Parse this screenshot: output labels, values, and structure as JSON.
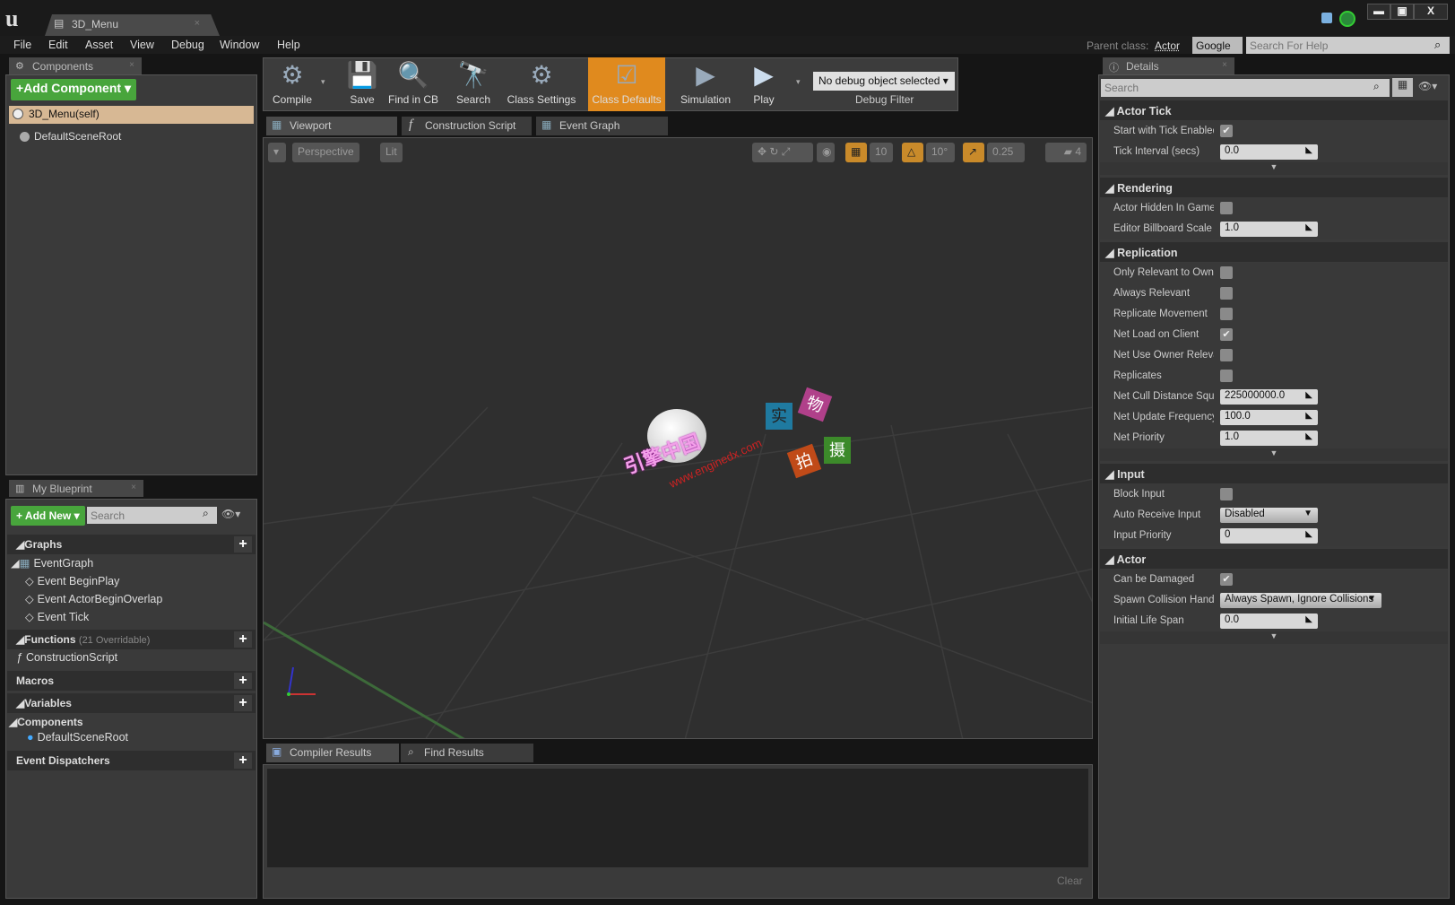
{
  "window": {
    "doc_tab": "3D_Menu",
    "controls": [
      "▬",
      "▣",
      "X"
    ]
  },
  "menu": [
    "File",
    "Edit",
    "Asset",
    "View",
    "Debug",
    "Window",
    "Help"
  ],
  "help": {
    "parent_class_label": "Parent class:",
    "parent_class": "Actor",
    "engine": "Google",
    "search_placeholder": "Search For Help"
  },
  "components": {
    "tab": "Components",
    "add_button": "Add Component",
    "items": [
      "3D_Menu(self)",
      "DefaultSceneRoot"
    ]
  },
  "my_blueprint": {
    "tab": "My Blueprint",
    "add_button": "Add New",
    "search_placeholder": "Search",
    "graphs": "Graphs",
    "event_graph": "EventGraph",
    "events": [
      "Event BeginPlay",
      "Event ActorBeginOverlap",
      "Event Tick"
    ],
    "functions": "Functions",
    "functions_note": "(21 Overridable)",
    "function_items": [
      "ConstructionScript"
    ],
    "macros": "Macros",
    "variables": "Variables",
    "components_group": "Components",
    "component_vars": [
      "DefaultSceneRoot"
    ],
    "dispatchers": "Event Dispatchers"
  },
  "toolbar": {
    "buttons": [
      {
        "label": "Compile",
        "icon": "compile-gear-icon"
      },
      {
        "label": "Save",
        "icon": "floppy-icon"
      },
      {
        "label": "Find in CB",
        "icon": "magnifier-icon"
      },
      {
        "label": "Search",
        "icon": "binoculars-icon"
      },
      {
        "label": "Class Settings",
        "icon": "class-settings-icon"
      },
      {
        "label": "Class Defaults",
        "icon": "class-defaults-icon",
        "active": true
      },
      {
        "label": "Simulation",
        "icon": "simulation-icon"
      },
      {
        "label": "Play",
        "icon": "play-icon"
      }
    ],
    "debug_select": "No debug object selected",
    "debug_label": "Debug Filter",
    "accent": "#e08a1e"
  },
  "editor_tabs": [
    "Viewport",
    "Construction Script",
    "Event Graph"
  ],
  "viewport": {
    "perspective": "Perspective",
    "lit": "Lit",
    "grid_snap": "10",
    "rot_snap": "10°",
    "scale_snap": "0.25",
    "camera_speed": "4"
  },
  "bottom": {
    "tabs": [
      "Compiler Results",
      "Find Results"
    ],
    "clear": "Clear"
  },
  "details": {
    "tab": "Details",
    "search_placeholder": "Search",
    "sections": [
      {
        "title": "Actor Tick",
        "rows": [
          {
            "label": "Start with Tick Enabled",
            "type": "check",
            "value": true
          },
          {
            "label": "Tick Interval (secs)",
            "type": "num",
            "value": "0.0"
          }
        ]
      },
      {
        "title": "Rendering",
        "rows": [
          {
            "label": "Actor Hidden In Game",
            "type": "check",
            "value": false
          },
          {
            "label": "Editor Billboard Scale",
            "type": "num",
            "value": "1.0"
          }
        ]
      },
      {
        "title": "Replication",
        "rows": [
          {
            "label": "Only Relevant to Owner",
            "type": "check",
            "value": false
          },
          {
            "label": "Always Relevant",
            "type": "check",
            "value": false
          },
          {
            "label": "Replicate Movement",
            "type": "check",
            "value": false
          },
          {
            "label": "Net Load on Client",
            "type": "check",
            "value": true
          },
          {
            "label": "Net Use Owner Relevancy",
            "type": "check",
            "value": false
          },
          {
            "label": "Replicates",
            "type": "check",
            "value": false
          },
          {
            "label": "Net Cull Distance Squared",
            "type": "num",
            "value": "225000000.0"
          },
          {
            "label": "Net Update Frequency",
            "type": "num",
            "value": "100.0"
          },
          {
            "label": "Net Priority",
            "type": "num",
            "value": "1.0"
          }
        ]
      },
      {
        "title": "Input",
        "rows": [
          {
            "label": "Block Input",
            "type": "check",
            "value": false
          },
          {
            "label": "Auto Receive Input",
            "type": "select",
            "value": "Disabled"
          },
          {
            "label": "Input Priority",
            "type": "num",
            "value": "0"
          }
        ]
      },
      {
        "title": "Actor",
        "rows": [
          {
            "label": "Can be Damaged",
            "type": "check",
            "value": true
          },
          {
            "label": "Spawn Collision Handling Method",
            "type": "select",
            "value": "Always Spawn, Ignore Collisions"
          },
          {
            "label": "Initial Life Span",
            "type": "num",
            "value": "0.0"
          }
        ]
      }
    ]
  }
}
